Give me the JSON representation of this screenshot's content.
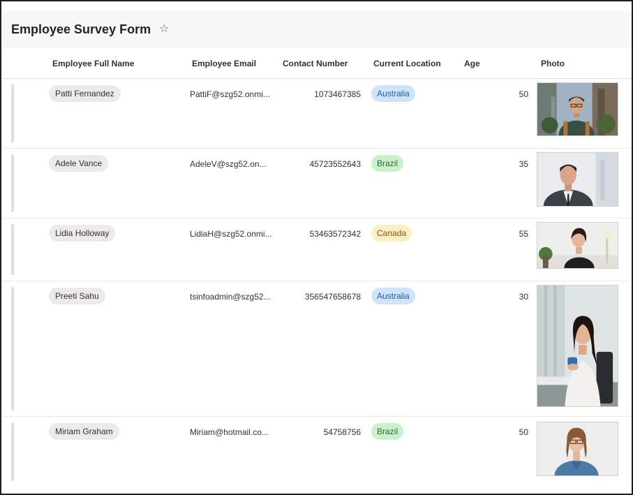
{
  "form": {
    "title": "Employee Survey Form",
    "favorite_icon": "star-outline-icon"
  },
  "columns": {
    "full_name": "Employee Full Name",
    "email": "Employee Email",
    "contact": "Contact Number",
    "location": "Current Location",
    "age": "Age",
    "photo": "Photo"
  },
  "rows": [
    {
      "name": "Patti Fernandez",
      "email": "PattiF@szg52.onmi...",
      "contact": "1073467385",
      "location": "Australia",
      "age": "50",
      "photo_icon": "person-photo-icon"
    },
    {
      "name": "Adele Vance",
      "email": "AdeleV@szg52.on...",
      "contact": "45723552643",
      "location": "Brazil",
      "age": "35",
      "photo_icon": "person-photo-icon"
    },
    {
      "name": "Lidia Holloway",
      "email": "LidiaH@szg52.onmi...",
      "contact": "53463572342",
      "location": "Canada",
      "age": "55",
      "photo_icon": "person-photo-icon"
    },
    {
      "name": "Preeti Sahu",
      "email": "tsinfoadmin@szg52...",
      "contact": "356547658678",
      "location": "Australia",
      "age": "30",
      "photo_icon": "person-photo-icon"
    },
    {
      "name": "Miriam Graham",
      "email": "Miriam@hotmail.co...",
      "contact": "54758756",
      "location": "Brazil",
      "age": "50",
      "photo_icon": "person-photo-icon"
    }
  ],
  "location_colors": {
    "Australia": {
      "bg": "#cfe4fa",
      "fg": "#1b5c9e"
    },
    "Brazil": {
      "bg": "#caf0cc",
      "fg": "#2e6b2f"
    },
    "Canada": {
      "bg": "#fcefc4",
      "fg": "#7a5a12"
    }
  }
}
